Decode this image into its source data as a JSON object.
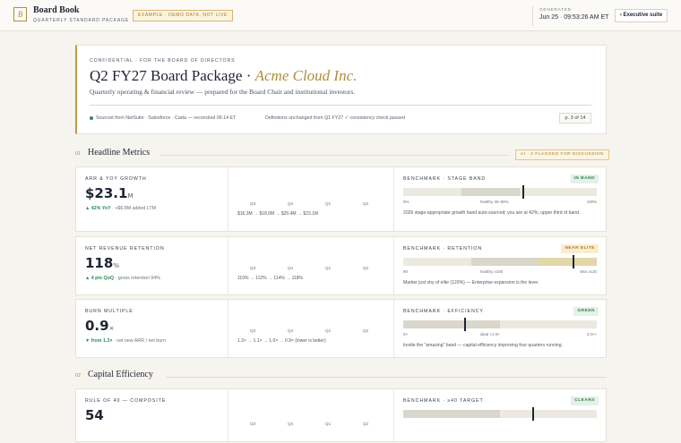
{
  "topbar": {
    "logo_letter": "B",
    "title": "Board Book",
    "subtitle": "QUARTERLY STANDARD PACKAGE",
    "demo_badge": "EXAMPLE · DEMO DATA, NOT LIVE",
    "generated_label": "GENERATED",
    "generated_time": "Jun 25 · 09:53:26 AM ET",
    "exec_button": "‹ Executive suite"
  },
  "header": {
    "eyebrow": "CONFIDENTIAL · FOR THE BOARD OF DIRECTORS",
    "title_main": "Q2 FY27 Board Package · ",
    "title_company": "Acme Cloud Inc.",
    "description": "Quarterly operating & financial review — prepared for the Board Chair and institutional investors.",
    "sources": "Sourced from NetSuite · Salesforce · Carta — reconciled 06:14 ET",
    "definitions": "Definitions unchanged from Q1 FY27 ✓ consistency check passed",
    "page_indicator": "p. 3 of 14"
  },
  "sections": [
    {
      "num": "01",
      "title": "Headline Metrics",
      "flag": "AI · 2 FLAGGED FOR DISCUSSION"
    },
    {
      "num": "02",
      "title": "Capital Efficiency"
    }
  ],
  "metrics": [
    {
      "label": "ARR & YOY GROWTH",
      "value": "$23.1",
      "unit": "M",
      "delta_strong": "▲ 42% YoY",
      "delta_rest": " · +$6.8M added LTM",
      "quarters": [
        "Q3",
        "Q4",
        "Q1",
        "Q2"
      ],
      "trail": "$16.3M → $18.0M → $20.4M → $23.1M",
      "bench_label": "BENCHMARK · STAGE BAND",
      "bench_pill": "IN BAND",
      "bench_pill_color": "#2f7d4d",
      "bench_ticks": [
        "0%",
        "healthy 30–50%",
        "100%"
      ],
      "bench_note": "2026 stage-appropriate growth band auto-sourced; you are at 42%, upper third of band.",
      "bench_marker": 0.62,
      "bench_band": [
        0.3,
        0.6
      ]
    },
    {
      "label": "NET REVENUE RETENTION",
      "value": "118",
      "unit": "%",
      "delta_strong": "▲ 4 pts QoQ",
      "delta_rest": " · gross retention 94%",
      "quarters": [
        "Q3",
        "Q4",
        "Q1",
        "Q2"
      ],
      "trail": "110% → 112% → 114% → 118%",
      "bench_label": "BENCHMARK · RETENTION",
      "bench_pill": "NEAR ELITE",
      "bench_pill_color": "#a77c27",
      "bench_ticks": [
        "90",
        "healthy ≥100",
        "elite ≥120"
      ],
      "bench_note": "Marker just shy of elite (120%) — Enterprise expansion is the lever.",
      "bench_marker": 0.88,
      "bench_band": [
        0.35,
        0.7
      ]
    },
    {
      "label": "BURN MULTIPLE",
      "value": "0.9",
      "unit": "×",
      "delta_strong": "▼ from 1.3×",
      "delta_rest": " · net new ARR / net burn",
      "quarters": [
        "Q3",
        "Q4",
        "Q1",
        "Q2"
      ],
      "trail": "1.3× → 1.1× → 1.0× → 0.9× (lower is better)",
      "bench_label": "BENCHMARK · EFFICIENCY",
      "bench_pill": "GREEN",
      "bench_pill_color": "#2f7d4d",
      "bench_ticks": [
        "0×",
        "ideal <1.0×",
        "2.0×+"
      ],
      "bench_note": "Inside the \"amazing\" band — capital efficiency improving four quarters running.",
      "bench_marker": 0.32,
      "bench_band": [
        0,
        0.5
      ]
    },
    {
      "label": "RULE OF 40 — COMPOSITE",
      "value": "54",
      "unit": "",
      "delta_strong": "",
      "delta_rest": "",
      "quarters": [
        "Q3",
        "Q4",
        "Q1",
        "Q2"
      ],
      "trail": "",
      "bench_label": "BENCHMARK · ≥40 TARGET",
      "bench_pill": "CLEARS",
      "bench_pill_color": "#2f7d4d",
      "bench_ticks": [],
      "bench_note": "",
      "bench_marker": 0.67,
      "bench_band": [
        0,
        0.5
      ]
    }
  ]
}
